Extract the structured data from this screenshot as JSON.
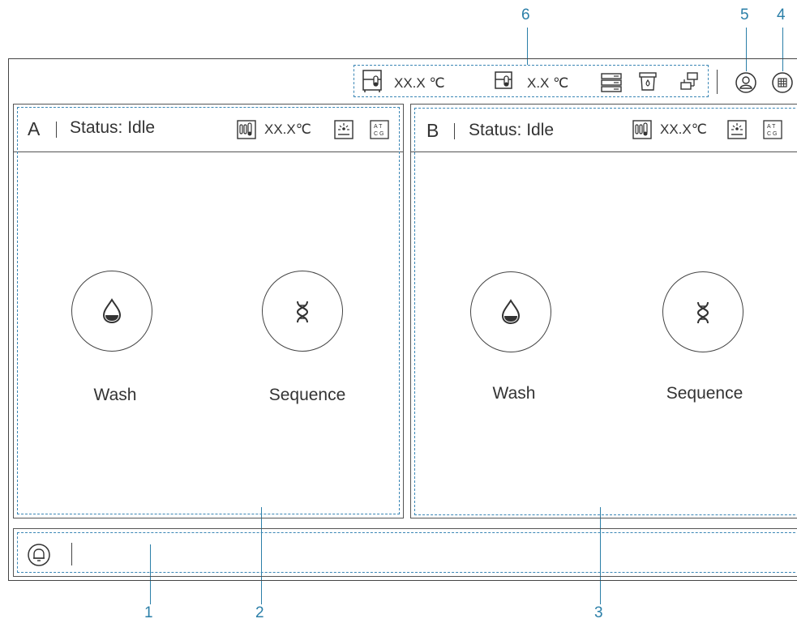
{
  "callouts": {
    "n1": "1",
    "n2": "2",
    "n3": "3",
    "n4": "4",
    "n5": "5",
    "n6": "6"
  },
  "toolbar": {
    "temp1": "XX.X ℃",
    "temp2": "X.X ℃"
  },
  "panel_a": {
    "letter": "A",
    "status": "Status: Idle",
    "temp": "XX.X℃",
    "wash_label": "Wash",
    "sequence_label": "Sequence"
  },
  "panel_b": {
    "letter": "B",
    "status": "Status: Idle",
    "temp": "XX.X℃",
    "wash_label": "Wash",
    "sequence_label": "Sequence"
  },
  "icons": {
    "toolbar": [
      "fridge-thermometer-icon",
      "module-thermometer-icon",
      "storage-rack-icon",
      "waste-container-icon",
      "network-icon",
      "user-icon",
      "apps-grid-icon"
    ],
    "panel": [
      "tube-thermometer-icon",
      "laser-icon",
      "atcg-icon",
      "water-drop-icon",
      "dna-icon"
    ],
    "footer": [
      "bell-icon"
    ]
  },
  "colors": {
    "annotation": "#2b7fa8",
    "dashed": "#3a86b5",
    "line": "#444444"
  }
}
